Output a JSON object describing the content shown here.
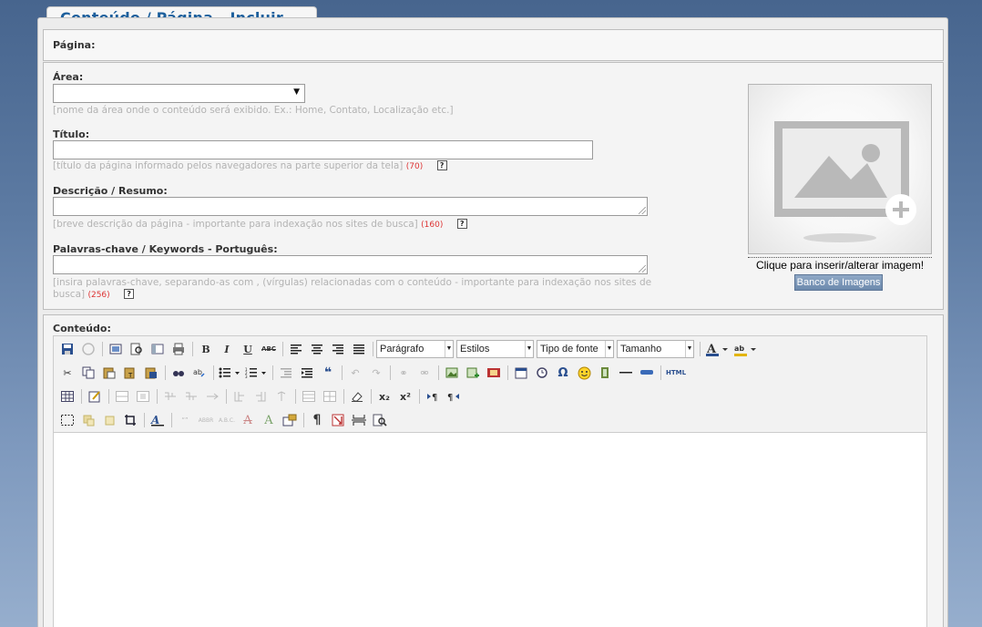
{
  "tab": {
    "title": "Conteúdo / Página - Incluir"
  },
  "pagina": {
    "label": "Página:"
  },
  "area": {
    "label": "Área:",
    "value": "",
    "hint": "[nome da área onde o conteúdo será exibido. Ex.: Home, Contato, Localização etc.]"
  },
  "titulo": {
    "label": "Título:",
    "value": "",
    "hint": "[título da página informado pelos navegadores na parte superior da tela]",
    "count": "70"
  },
  "descricao": {
    "label": "Descrição / Resumo:",
    "value": "",
    "hint": "[breve descrição da página - importante para indexação nos sites de busca]",
    "count": "160"
  },
  "keywords": {
    "label": "Palavras-chave / Keywords - Português:",
    "value": "",
    "hint": "[insira palavras-chave, separando-as com , (vírgulas) relacionadas com o conteúdo - importante para indexação nos sites de busca]",
    "count": "256"
  },
  "help_glyph": "?",
  "image": {
    "caption": "Clique para inserir/alterar imagem!",
    "bank_button": "Banco de Imagens"
  },
  "conteudo": {
    "label": "Conteúdo:"
  },
  "editor": {
    "format_select": "Parágrafo",
    "styles_select": "Estilos",
    "font_select": "Tipo de fonte",
    "size_select": "Tamanho",
    "bold": "B",
    "italic": "I",
    "underline": "U",
    "strike": "ABC",
    "html_button": "HTML",
    "omega": "Ω",
    "pilcrow": "¶",
    "sub": "x₂",
    "sup": "x²",
    "quote": "❝",
    "body_text": ""
  },
  "colors": {
    "accent": "#1c5f9c",
    "hint": "#b3b3b3",
    "counter": "#dd3333",
    "button": "#7b96b8"
  }
}
